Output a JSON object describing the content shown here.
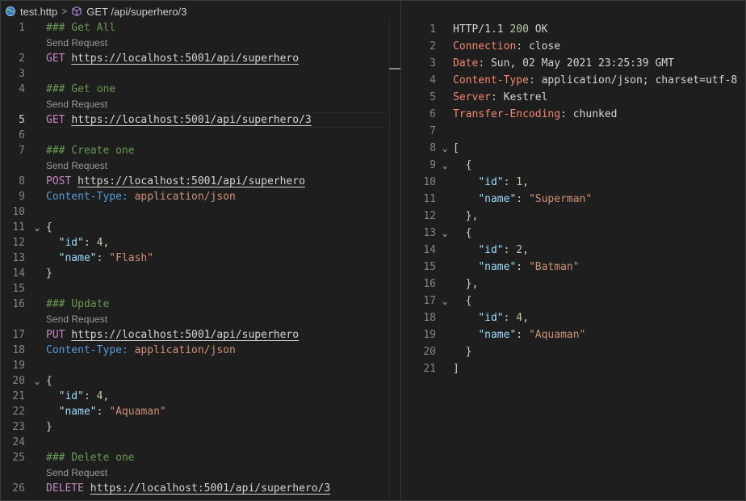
{
  "breadcrumb": {
    "file": "test.http",
    "separator": ">",
    "request": "GET /api/superhero/3"
  },
  "lens": "Send Request",
  "editor": {
    "lines": [
      {
        "n": "1",
        "comment": "### Get All"
      },
      {
        "n": "2",
        "method": "GET",
        "url": "https://localhost:5001/api/superhero"
      },
      {
        "n": "3"
      },
      {
        "n": "4",
        "comment": "### Get one"
      },
      {
        "n": "5",
        "method": "GET",
        "url": "https://localhost:5001/api/superhero/3"
      },
      {
        "n": "6"
      },
      {
        "n": "7",
        "comment": "### Create one"
      },
      {
        "n": "8",
        "method": "POST",
        "url": "https://localhost:5001/api/superhero"
      },
      {
        "n": "9",
        "header_key": "Content-Type:",
        "header_val": "application/json"
      },
      {
        "n": "10"
      },
      {
        "n": "11",
        "brace": "{",
        "fold": "⌄"
      },
      {
        "n": "12",
        "key": "\"id\"",
        "sep": ": ",
        "num": "4",
        "end": ","
      },
      {
        "n": "13",
        "key": "\"name\"",
        "sep": ": ",
        "str": "\"Flash\""
      },
      {
        "n": "14",
        "brace": "}"
      },
      {
        "n": "15"
      },
      {
        "n": "16",
        "comment": "### Update"
      },
      {
        "n": "17",
        "method": "PUT",
        "url": "https://localhost:5001/api/superhero"
      },
      {
        "n": "18",
        "header_key": "Content-Type:",
        "header_val": "application/json"
      },
      {
        "n": "19"
      },
      {
        "n": "20",
        "brace": "{",
        "fold": "⌄"
      },
      {
        "n": "21",
        "key": "\"id\"",
        "sep": ": ",
        "num": "4",
        "end": ","
      },
      {
        "n": "22",
        "key": "\"name\"",
        "sep": ": ",
        "str": "\"Aquaman\""
      },
      {
        "n": "23",
        "brace": "}"
      },
      {
        "n": "24"
      },
      {
        "n": "25",
        "comment": "### Delete one"
      },
      {
        "n": "26",
        "method": "DELETE",
        "url": "https://localhost:5001/api/superhero/3"
      }
    ]
  },
  "response": {
    "status_proto": "HTTP/1.1",
    "status_code": "200",
    "status_text": "OK",
    "headers": [
      {
        "key": "Connection",
        "value": "close"
      },
      {
        "key": "Date",
        "value": "Sun, 02 May 2021 23:25:39 GMT"
      },
      {
        "key": "Content-Type",
        "value": "application/json; charset=utf-8"
      },
      {
        "key": "Server",
        "value": "Kestrel"
      },
      {
        "key": "Transfer-Encoding",
        "value": "chunked"
      }
    ],
    "body": [
      {
        "n": "7",
        "text": ""
      },
      {
        "n": "8",
        "text": "[",
        "fold": true
      },
      {
        "n": "9",
        "text": "  {",
        "fold": true
      },
      {
        "n": "10",
        "key": "\"id\"",
        "num": "1",
        "end": ",",
        "indent": "    "
      },
      {
        "n": "11",
        "key": "\"name\"",
        "str": "\"Superman\"",
        "indent": "    "
      },
      {
        "n": "12",
        "text": "  },"
      },
      {
        "n": "13",
        "text": "  {",
        "fold": true
      },
      {
        "n": "14",
        "key": "\"id\"",
        "num": "2",
        "end": ",",
        "indent": "    "
      },
      {
        "n": "15",
        "key": "\"name\"",
        "str": "\"Batman\"",
        "indent": "    "
      },
      {
        "n": "16",
        "text": "  },"
      },
      {
        "n": "17",
        "text": "  {",
        "fold": true
      },
      {
        "n": "18",
        "key": "\"id\"",
        "num": "4",
        "end": ",",
        "indent": "    "
      },
      {
        "n": "19",
        "key": "\"name\"",
        "str": "\"Aquaman\"",
        "indent": "    "
      },
      {
        "n": "20",
        "text": "  }"
      },
      {
        "n": "21",
        "text": "]"
      }
    ]
  },
  "colors": {
    "background": "#1e1e1e",
    "comment": "#6a9955",
    "method": "#c586c0",
    "key": "#9cdcfe",
    "string": "#ce9178",
    "number": "#b5cea8",
    "header_key_response": "#f48771"
  }
}
